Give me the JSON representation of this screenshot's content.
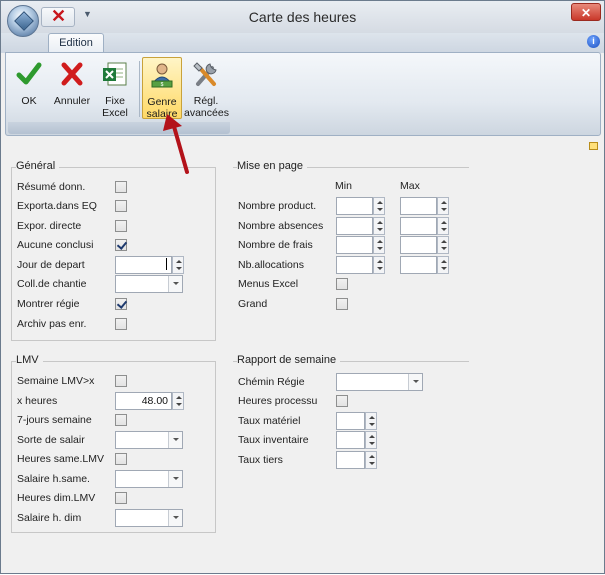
{
  "window": {
    "title": "Carte des heures",
    "close_label": "✕",
    "help_label": "i"
  },
  "ribbon": {
    "tab_label": "Edition",
    "buttons": [
      {
        "label_1": "OK",
        "label_2": "",
        "icon": "check-icon"
      },
      {
        "label_1": "Annuler",
        "label_2": "",
        "icon": "cancel-x-icon"
      },
      {
        "label_1": "Fixe",
        "label_2": "Excel",
        "icon": "excel-icon"
      },
      {
        "label_1": "Genre",
        "label_2": "salaire",
        "icon": "wage-type-icon",
        "active": true
      },
      {
        "label_1": "Régl.",
        "label_2": "avancées",
        "icon": "tools-icon"
      }
    ]
  },
  "general": {
    "title": "Général",
    "rows": [
      {
        "label": "Résumé donn.",
        "type": "checkbox",
        "checked": false
      },
      {
        "label": "Exporta.dans EQ",
        "type": "checkbox",
        "checked": false
      },
      {
        "label": "Expor. directe",
        "type": "checkbox",
        "checked": false
      },
      {
        "label": "Aucune conclusi",
        "type": "checkbox",
        "checked": true
      },
      {
        "label": "Jour de depart",
        "type": "spinner",
        "value": ""
      },
      {
        "label": "Coll.de chantie",
        "type": "combo",
        "value": ""
      },
      {
        "label": "Montrer régie",
        "type": "checkbox",
        "checked": true
      },
      {
        "label": "Archiv pas enr.",
        "type": "checkbox",
        "checked": false
      }
    ]
  },
  "mise_en_page": {
    "title": "Mise en page",
    "col_min": "Min",
    "col_max": "Max",
    "rows": [
      {
        "label": "Nombre product.",
        "min": "",
        "max": ""
      },
      {
        "label": "Nombre absences",
        "min": "",
        "max": ""
      },
      {
        "label": "Nombre de frais",
        "min": "",
        "max": ""
      },
      {
        "label": "Nb.allocations",
        "min": "",
        "max": ""
      }
    ],
    "checks": [
      {
        "label": "Menus Excel",
        "checked": false
      },
      {
        "label": "Grand",
        "checked": false
      }
    ]
  },
  "lmv": {
    "title": "LMV",
    "rows": [
      {
        "label": "Semaine LMV>x",
        "type": "checkbox",
        "checked": false
      },
      {
        "label": "x heures",
        "type": "spinner",
        "value": "48.00"
      },
      {
        "label": "7-jours semaine",
        "type": "checkbox",
        "checked": false
      },
      {
        "label": "Sorte de salair",
        "type": "combo",
        "value": ""
      },
      {
        "label": "Heures same.LMV",
        "type": "checkbox",
        "checked": false
      },
      {
        "label": "Salaire h.same.",
        "type": "combo",
        "value": ""
      },
      {
        "label": "Heures dim.LMV",
        "type": "checkbox",
        "checked": false
      },
      {
        "label": "Salaire h. dim",
        "type": "combo",
        "value": ""
      }
    ]
  },
  "rapport": {
    "title": "Rapport de semaine",
    "rows": [
      {
        "label": "Chémin Régie",
        "type": "combo",
        "value": ""
      },
      {
        "label": "Heures processu",
        "type": "checkbox",
        "checked": false
      },
      {
        "label": "Taux matériel",
        "type": "spinner",
        "value": ""
      },
      {
        "label": "Taux inventaire",
        "type": "spinner",
        "value": ""
      },
      {
        "label": "Taux tiers",
        "type": "spinner",
        "value": ""
      }
    ]
  },
  "colors": {
    "accent_arrow": "#b3121a",
    "active_button": "#ffd966",
    "checkmark": "#1e3a6e"
  }
}
